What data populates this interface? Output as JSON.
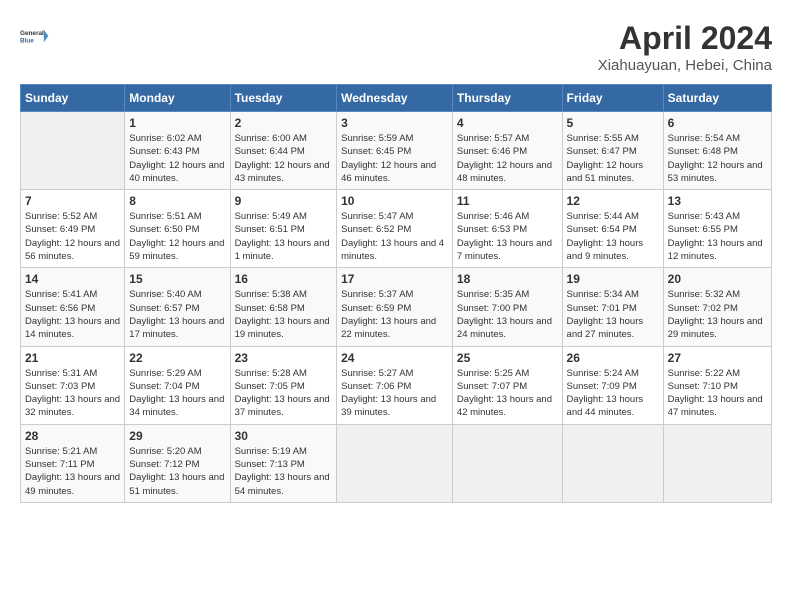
{
  "header": {
    "logo_line1": "General",
    "logo_line2": "Blue",
    "title": "April 2024",
    "subtitle": "Xiahuayuan, Hebei, China"
  },
  "days_of_week": [
    "Sunday",
    "Monday",
    "Tuesday",
    "Wednesday",
    "Thursday",
    "Friday",
    "Saturday"
  ],
  "weeks": [
    [
      {
        "day": "",
        "sunrise": "",
        "sunset": "",
        "daylight": ""
      },
      {
        "day": "1",
        "sunrise": "Sunrise: 6:02 AM",
        "sunset": "Sunset: 6:43 PM",
        "daylight": "Daylight: 12 hours and 40 minutes."
      },
      {
        "day": "2",
        "sunrise": "Sunrise: 6:00 AM",
        "sunset": "Sunset: 6:44 PM",
        "daylight": "Daylight: 12 hours and 43 minutes."
      },
      {
        "day": "3",
        "sunrise": "Sunrise: 5:59 AM",
        "sunset": "Sunset: 6:45 PM",
        "daylight": "Daylight: 12 hours and 46 minutes."
      },
      {
        "day": "4",
        "sunrise": "Sunrise: 5:57 AM",
        "sunset": "Sunset: 6:46 PM",
        "daylight": "Daylight: 12 hours and 48 minutes."
      },
      {
        "day": "5",
        "sunrise": "Sunrise: 5:55 AM",
        "sunset": "Sunset: 6:47 PM",
        "daylight": "Daylight: 12 hours and 51 minutes."
      },
      {
        "day": "6",
        "sunrise": "Sunrise: 5:54 AM",
        "sunset": "Sunset: 6:48 PM",
        "daylight": "Daylight: 12 hours and 53 minutes."
      }
    ],
    [
      {
        "day": "7",
        "sunrise": "Sunrise: 5:52 AM",
        "sunset": "Sunset: 6:49 PM",
        "daylight": "Daylight: 12 hours and 56 minutes."
      },
      {
        "day": "8",
        "sunrise": "Sunrise: 5:51 AM",
        "sunset": "Sunset: 6:50 PM",
        "daylight": "Daylight: 12 hours and 59 minutes."
      },
      {
        "day": "9",
        "sunrise": "Sunrise: 5:49 AM",
        "sunset": "Sunset: 6:51 PM",
        "daylight": "Daylight: 13 hours and 1 minute."
      },
      {
        "day": "10",
        "sunrise": "Sunrise: 5:47 AM",
        "sunset": "Sunset: 6:52 PM",
        "daylight": "Daylight: 13 hours and 4 minutes."
      },
      {
        "day": "11",
        "sunrise": "Sunrise: 5:46 AM",
        "sunset": "Sunset: 6:53 PM",
        "daylight": "Daylight: 13 hours and 7 minutes."
      },
      {
        "day": "12",
        "sunrise": "Sunrise: 5:44 AM",
        "sunset": "Sunset: 6:54 PM",
        "daylight": "Daylight: 13 hours and 9 minutes."
      },
      {
        "day": "13",
        "sunrise": "Sunrise: 5:43 AM",
        "sunset": "Sunset: 6:55 PM",
        "daylight": "Daylight: 13 hours and 12 minutes."
      }
    ],
    [
      {
        "day": "14",
        "sunrise": "Sunrise: 5:41 AM",
        "sunset": "Sunset: 6:56 PM",
        "daylight": "Daylight: 13 hours and 14 minutes."
      },
      {
        "day": "15",
        "sunrise": "Sunrise: 5:40 AM",
        "sunset": "Sunset: 6:57 PM",
        "daylight": "Daylight: 13 hours and 17 minutes."
      },
      {
        "day": "16",
        "sunrise": "Sunrise: 5:38 AM",
        "sunset": "Sunset: 6:58 PM",
        "daylight": "Daylight: 13 hours and 19 minutes."
      },
      {
        "day": "17",
        "sunrise": "Sunrise: 5:37 AM",
        "sunset": "Sunset: 6:59 PM",
        "daylight": "Daylight: 13 hours and 22 minutes."
      },
      {
        "day": "18",
        "sunrise": "Sunrise: 5:35 AM",
        "sunset": "Sunset: 7:00 PM",
        "daylight": "Daylight: 13 hours and 24 minutes."
      },
      {
        "day": "19",
        "sunrise": "Sunrise: 5:34 AM",
        "sunset": "Sunset: 7:01 PM",
        "daylight": "Daylight: 13 hours and 27 minutes."
      },
      {
        "day": "20",
        "sunrise": "Sunrise: 5:32 AM",
        "sunset": "Sunset: 7:02 PM",
        "daylight": "Daylight: 13 hours and 29 minutes."
      }
    ],
    [
      {
        "day": "21",
        "sunrise": "Sunrise: 5:31 AM",
        "sunset": "Sunset: 7:03 PM",
        "daylight": "Daylight: 13 hours and 32 minutes."
      },
      {
        "day": "22",
        "sunrise": "Sunrise: 5:29 AM",
        "sunset": "Sunset: 7:04 PM",
        "daylight": "Daylight: 13 hours and 34 minutes."
      },
      {
        "day": "23",
        "sunrise": "Sunrise: 5:28 AM",
        "sunset": "Sunset: 7:05 PM",
        "daylight": "Daylight: 13 hours and 37 minutes."
      },
      {
        "day": "24",
        "sunrise": "Sunrise: 5:27 AM",
        "sunset": "Sunset: 7:06 PM",
        "daylight": "Daylight: 13 hours and 39 minutes."
      },
      {
        "day": "25",
        "sunrise": "Sunrise: 5:25 AM",
        "sunset": "Sunset: 7:07 PM",
        "daylight": "Daylight: 13 hours and 42 minutes."
      },
      {
        "day": "26",
        "sunrise": "Sunrise: 5:24 AM",
        "sunset": "Sunset: 7:09 PM",
        "daylight": "Daylight: 13 hours and 44 minutes."
      },
      {
        "day": "27",
        "sunrise": "Sunrise: 5:22 AM",
        "sunset": "Sunset: 7:10 PM",
        "daylight": "Daylight: 13 hours and 47 minutes."
      }
    ],
    [
      {
        "day": "28",
        "sunrise": "Sunrise: 5:21 AM",
        "sunset": "Sunset: 7:11 PM",
        "daylight": "Daylight: 13 hours and 49 minutes."
      },
      {
        "day": "29",
        "sunrise": "Sunrise: 5:20 AM",
        "sunset": "Sunset: 7:12 PM",
        "daylight": "Daylight: 13 hours and 51 minutes."
      },
      {
        "day": "30",
        "sunrise": "Sunrise: 5:19 AM",
        "sunset": "Sunset: 7:13 PM",
        "daylight": "Daylight: 13 hours and 54 minutes."
      },
      {
        "day": "",
        "sunrise": "",
        "sunset": "",
        "daylight": ""
      },
      {
        "day": "",
        "sunrise": "",
        "sunset": "",
        "daylight": ""
      },
      {
        "day": "",
        "sunrise": "",
        "sunset": "",
        "daylight": ""
      },
      {
        "day": "",
        "sunrise": "",
        "sunset": "",
        "daylight": ""
      }
    ]
  ]
}
